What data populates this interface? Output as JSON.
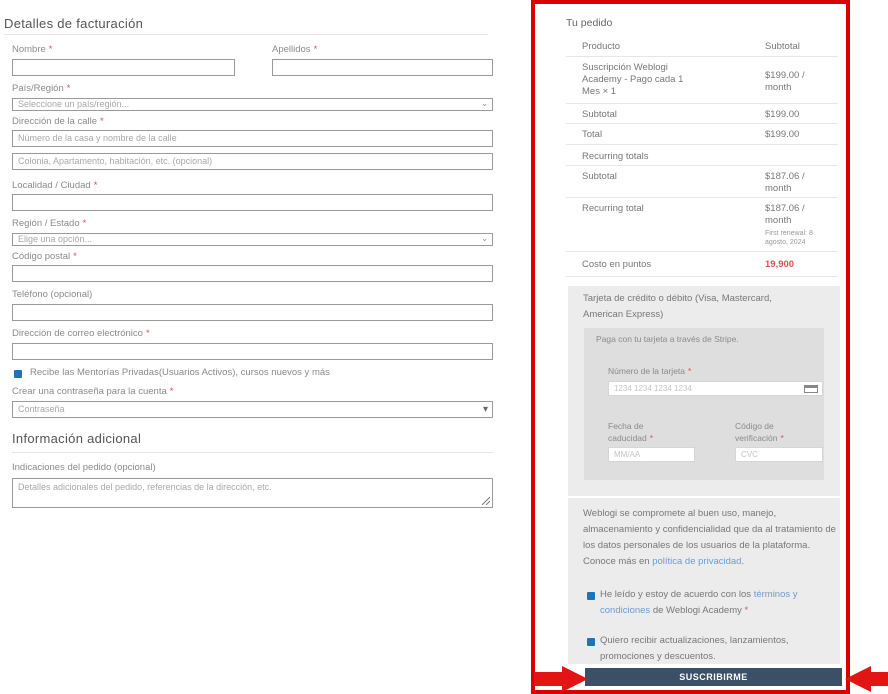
{
  "billing": {
    "title": "Detalles de facturación",
    "first_name_label": "Nombre",
    "last_name_label": "Apellidos",
    "country_label": "País/Región",
    "country_placeholder": "Seleccione un país/región...",
    "street_label": "Dirección de la calle",
    "street_placeholder": "Número de la casa y nombre de la calle",
    "street2_placeholder": "Colonia, Apartamento, habitación, etc. (opcional)",
    "city_label": "Localidad / Ciudad",
    "state_label": "Región / Estado",
    "state_placeholder": "Elige una opción...",
    "postcode_label": "Código postal",
    "phone_label": "Teléfono (opcional)",
    "email_label": "Dirección de correo electrónico",
    "newsletter_label": "Recibe las Mentorías Privadas(Usuarios Activos), cursos nuevos y más",
    "password_label": "Crear una contraseña para la cuenta",
    "password_placeholder": "Contraseña",
    "required_mark": "*"
  },
  "additional": {
    "title": "Información adicional",
    "notes_label": "Indicaciones del pedido (opcional)",
    "notes_placeholder": "Detalles adicionales del pedido, referencias de la dirección, etc."
  },
  "order": {
    "title": "Tu pedido",
    "col_product": "Producto",
    "col_subtotal": "Subtotal",
    "item_name": "Suscripción Weblogi Academy - Pago cada 1 Mes × 1",
    "item_price": "$199.00 / month",
    "subtotal_label": "Subtotal",
    "subtotal_value": "$199.00",
    "total_label": "Total",
    "total_value": "$199.00",
    "recurring_totals": "Recurring totals",
    "rec_subtotal_label": "Subtotal",
    "rec_subtotal_value": "$187.06 / month",
    "rec_total_label": "Recurring total",
    "rec_total_value": "$187.06 / month",
    "first_renewal": "First renewal: 8 agosto, 2024",
    "points_label": "Costo en puntos",
    "points_value": "19,900"
  },
  "payment": {
    "method_label": "Tarjeta de crédito o débito (Visa, Mastercard, American Express)",
    "stripe_note": "Paga con tu tarjeta a través de Stripe.",
    "card_number_label": "Número de la tarjeta",
    "card_number_placeholder": "1234 1234 1234 1234",
    "expiry_label_1": "Fecha de",
    "expiry_label_2": "caducidad",
    "expiry_placeholder": "MM/AA",
    "cvc_label_1": "Código de",
    "cvc_label_2": "verificación",
    "cvc_placeholder": "CVC"
  },
  "privacy": {
    "text": "Weblogi se compromete al buen uso, manejo, almacenamiento y confidencialidad que da al tratamiento de los datos personales de los usuarios de la plataforma. Conoce más en",
    "link": "política de privacidad",
    "terms_prefix": "He leído y estoy de acuerdo con los",
    "terms_link": "términos y condiciones",
    "terms_suffix": "de Weblogi Academy",
    "updates_label": "Quiero recibir actualizaciones, lanzamientos, promociones y descuentos."
  },
  "submit_label": "SUSCRIBIRME",
  "colors": {
    "accent": "#1f73b7",
    "button": "#3b5066",
    "highlight": "#e21414",
    "price": "#d9534f"
  }
}
